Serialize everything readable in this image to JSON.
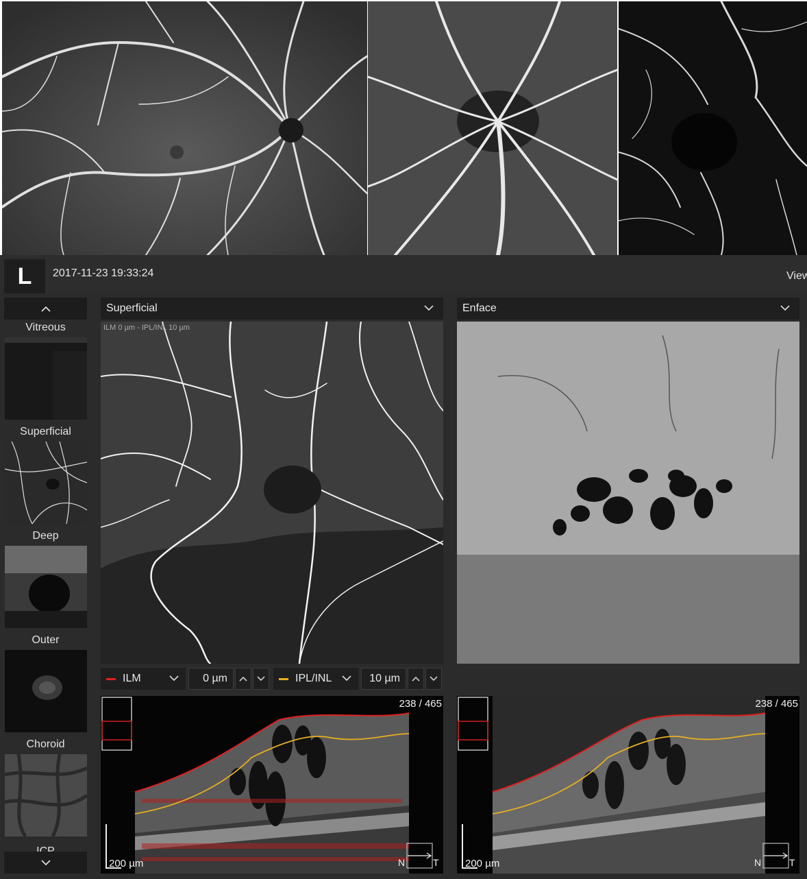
{
  "header": {
    "eye": "L",
    "timestamp": "2017-11-23 19:33:24",
    "view_label": "View"
  },
  "sidebar": {
    "layers": [
      {
        "label": "Vitreous"
      },
      {
        "label": "Superficial"
      },
      {
        "label": "Deep"
      },
      {
        "label": "Outer"
      },
      {
        "label": "Choroid"
      },
      {
        "label": "ICP"
      }
    ]
  },
  "left_pane": {
    "dropdown": "Superficial",
    "overlay": "ILM 0 µm - IPL/INL 10 µm",
    "upper_boundary": {
      "label": "ILM",
      "color": "#e02020"
    },
    "upper_offset": "0 µm",
    "lower_boundary": {
      "label": "IPL/INL",
      "color": "#e8b020"
    },
    "lower_offset": "10 µm",
    "slice": "238 / 465",
    "scale": "200 µm",
    "orient_n": "N",
    "orient_t": "T"
  },
  "right_pane": {
    "dropdown": "Enface",
    "slice": "238 / 465",
    "scale": "200 µm",
    "orient_n": "N",
    "orient_t": "T"
  }
}
